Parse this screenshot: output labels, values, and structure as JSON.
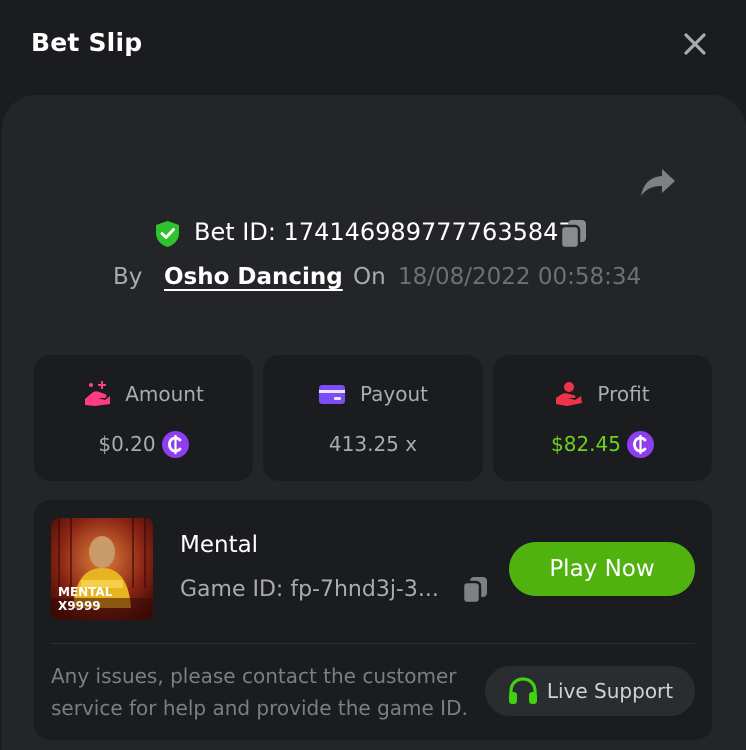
{
  "header": {
    "title": "Bet Slip",
    "close_icon": "close-icon"
  },
  "bet": {
    "share_icon": "share-arrow-icon",
    "verified_icon": "shield-check-icon",
    "bet_id_label": "Bet ID: 1741469897777635847",
    "copy_icon": "copy-icon",
    "by_label": "By",
    "username": "Osho Dancing",
    "on_label": "On",
    "datetime": "18/08/2022 00:58:34"
  },
  "stats": [
    {
      "label": "Amount",
      "value": "$0.20",
      "icon": "amount-hand-icon",
      "currency_icon": "coin-icon"
    },
    {
      "label": "Payout",
      "value": "413.25 x",
      "icon": "wallet-card-icon"
    },
    {
      "label": "Profit",
      "value": "$82.45",
      "icon": "profit-hand-icon",
      "currency_icon": "coin-icon"
    }
  ],
  "game": {
    "thumbnail_title": "MENTAL",
    "thumbnail_sub": "X9999",
    "name": "Mental",
    "game_id_label": "Game ID: fp-7hnd3j-3...",
    "play_label": "Play Now",
    "help_text": "Any issues, please contact the customer service for help and provide the game ID.",
    "support_label": "Live Support",
    "support_icon": "headset-icon"
  },
  "colors": {
    "background": "#1b1c1f",
    "panel": "#242528",
    "accent_green": "#50b20f",
    "profit_green": "#6cd31b",
    "coin_purple": "#8f3df0",
    "amount_pink": "#ff3d7f",
    "payout_purple": "#7b4df5",
    "profit_red": "#f0334b"
  }
}
